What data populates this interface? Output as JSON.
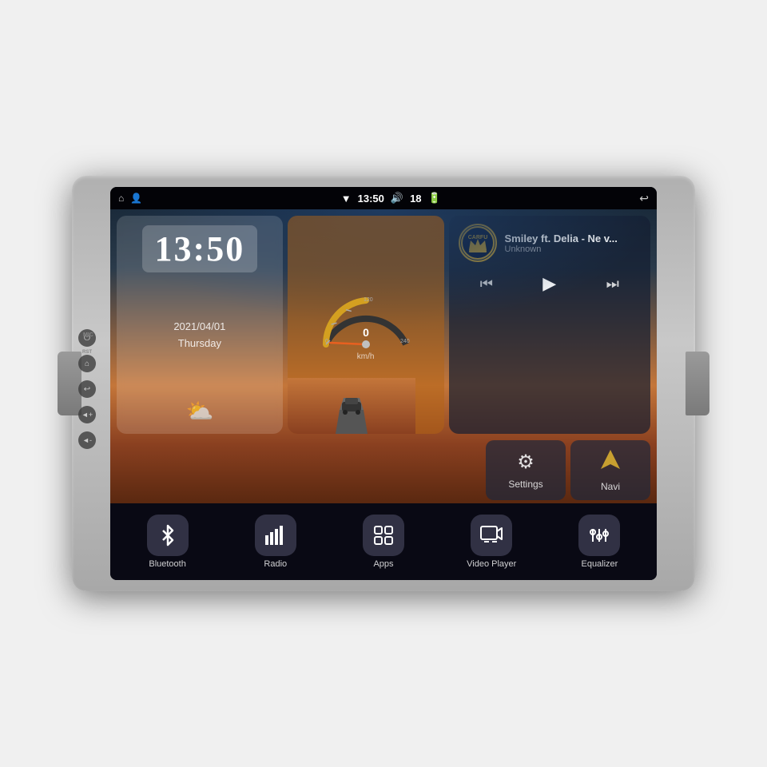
{
  "device": {
    "title": "Car Head Unit"
  },
  "status_bar": {
    "left_icons": [
      "home",
      "person"
    ],
    "time": "13:50",
    "wifi_icon": "wifi",
    "volume": "18",
    "battery_icon": "battery",
    "back_icon": "back"
  },
  "side_controls": {
    "mic_label": "MIC",
    "rst_label": "RST",
    "buttons": [
      "power",
      "home",
      "back",
      "volume_up",
      "volume_down"
    ]
  },
  "clock_widget": {
    "time": "13:50",
    "date": "2021/04/01",
    "day": "Thursday",
    "weather_icon": "partly-cloudy"
  },
  "speedometer": {
    "speed": "0",
    "unit": "km/h",
    "max": "240"
  },
  "music_widget": {
    "logo_text": "CARFU",
    "title": "Smiley ft. Delia - Ne v...",
    "artist": "Unknown",
    "prev_label": "⏮",
    "play_label": "▶",
    "next_label": "⏭"
  },
  "settings_widget": {
    "icon": "gear",
    "label": "Settings"
  },
  "navi_widget": {
    "icon": "navigation",
    "label": "Navi"
  },
  "app_bar": {
    "apps": [
      {
        "id": "bluetooth",
        "icon": "bluetooth",
        "label": "Bluetooth"
      },
      {
        "id": "radio",
        "icon": "radio",
        "label": "Radio"
      },
      {
        "id": "apps",
        "icon": "apps",
        "label": "Apps"
      },
      {
        "id": "video-player",
        "icon": "video",
        "label": "Video Player"
      },
      {
        "id": "equalizer",
        "icon": "equalizer",
        "label": "Equalizer"
      }
    ]
  },
  "colors": {
    "accent": "#c8a030",
    "bg_dark": "#0a0a1a",
    "bg_warm": "#c4763a"
  }
}
